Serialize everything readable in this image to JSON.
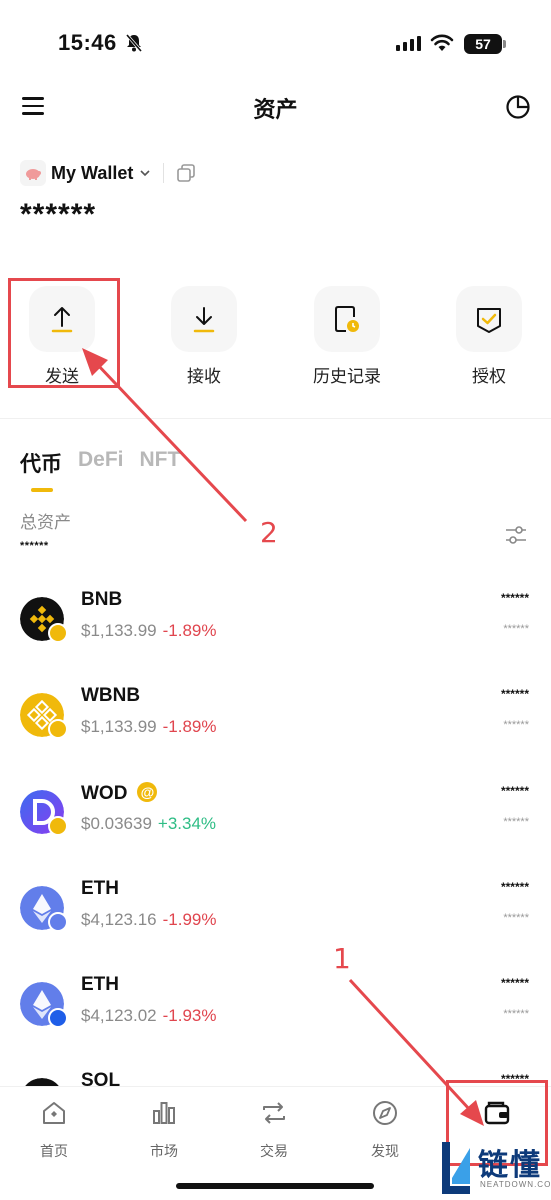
{
  "status_bar": {
    "time": "15:46",
    "battery": "57"
  },
  "header": {
    "title": "资产"
  },
  "wallet": {
    "name": "My Wallet",
    "balance": "******"
  },
  "actions": [
    {
      "label": "发送",
      "icon": "send-arrow-up-icon"
    },
    {
      "label": "接收",
      "icon": "receive-arrow-down-icon"
    },
    {
      "label": "历史记录",
      "icon": "history-icon"
    },
    {
      "label": "授权",
      "icon": "authorize-shield-icon"
    }
  ],
  "tabs": [
    {
      "label": "代币",
      "active": true
    },
    {
      "label": "DeFi",
      "active": false
    },
    {
      "label": "NFT",
      "active": false
    }
  ],
  "total": {
    "label": "总资产",
    "value": "******"
  },
  "tokens": [
    {
      "symbol": "BNB",
      "price": "$1,133.99",
      "change": "-1.89%",
      "trend": "down",
      "value": "******",
      "sub_value": "******",
      "color": "#f0b90b"
    },
    {
      "symbol": "WBNB",
      "price": "$1,133.99",
      "change": "-1.89%",
      "trend": "down",
      "value": "******",
      "sub_value": "******",
      "color": "#f0b90b"
    },
    {
      "symbol": "WOD",
      "badge": "@",
      "price": "$0.03639",
      "change": "+3.34%",
      "trend": "up",
      "value": "******",
      "sub_value": "******",
      "color": "#5b4ee8"
    },
    {
      "symbol": "ETH",
      "price": "$4,123.16",
      "change": "-1.99%",
      "trend": "down",
      "value": "******",
      "sub_value": "******",
      "color": "#627eea"
    },
    {
      "symbol": "ETH",
      "price": "$4,123.02",
      "change": "-1.93%",
      "trend": "down",
      "value": "******",
      "sub_value": "******",
      "color": "#627eea"
    },
    {
      "symbol": "SOL",
      "price": "",
      "change": "",
      "trend": "",
      "value": "******",
      "sub_value": "",
      "color": "#111111"
    }
  ],
  "bottom_nav": [
    {
      "label": "首页",
      "icon": "home-icon"
    },
    {
      "label": "市场",
      "icon": "market-chart-icon"
    },
    {
      "label": "交易",
      "icon": "swap-icon"
    },
    {
      "label": "发现",
      "icon": "compass-icon"
    },
    {
      "label": "",
      "icon": "wallet-icon",
      "active": true
    }
  ],
  "annotations": {
    "step1": "1",
    "step2": "2"
  },
  "watermark": {
    "brand": "链懂",
    "site": "NEATDOWN.COM"
  },
  "colors": {
    "accent": "#f0b90b",
    "negative": "#e0454e",
    "positive": "#2ebd85",
    "annotation": "#e5484d"
  }
}
